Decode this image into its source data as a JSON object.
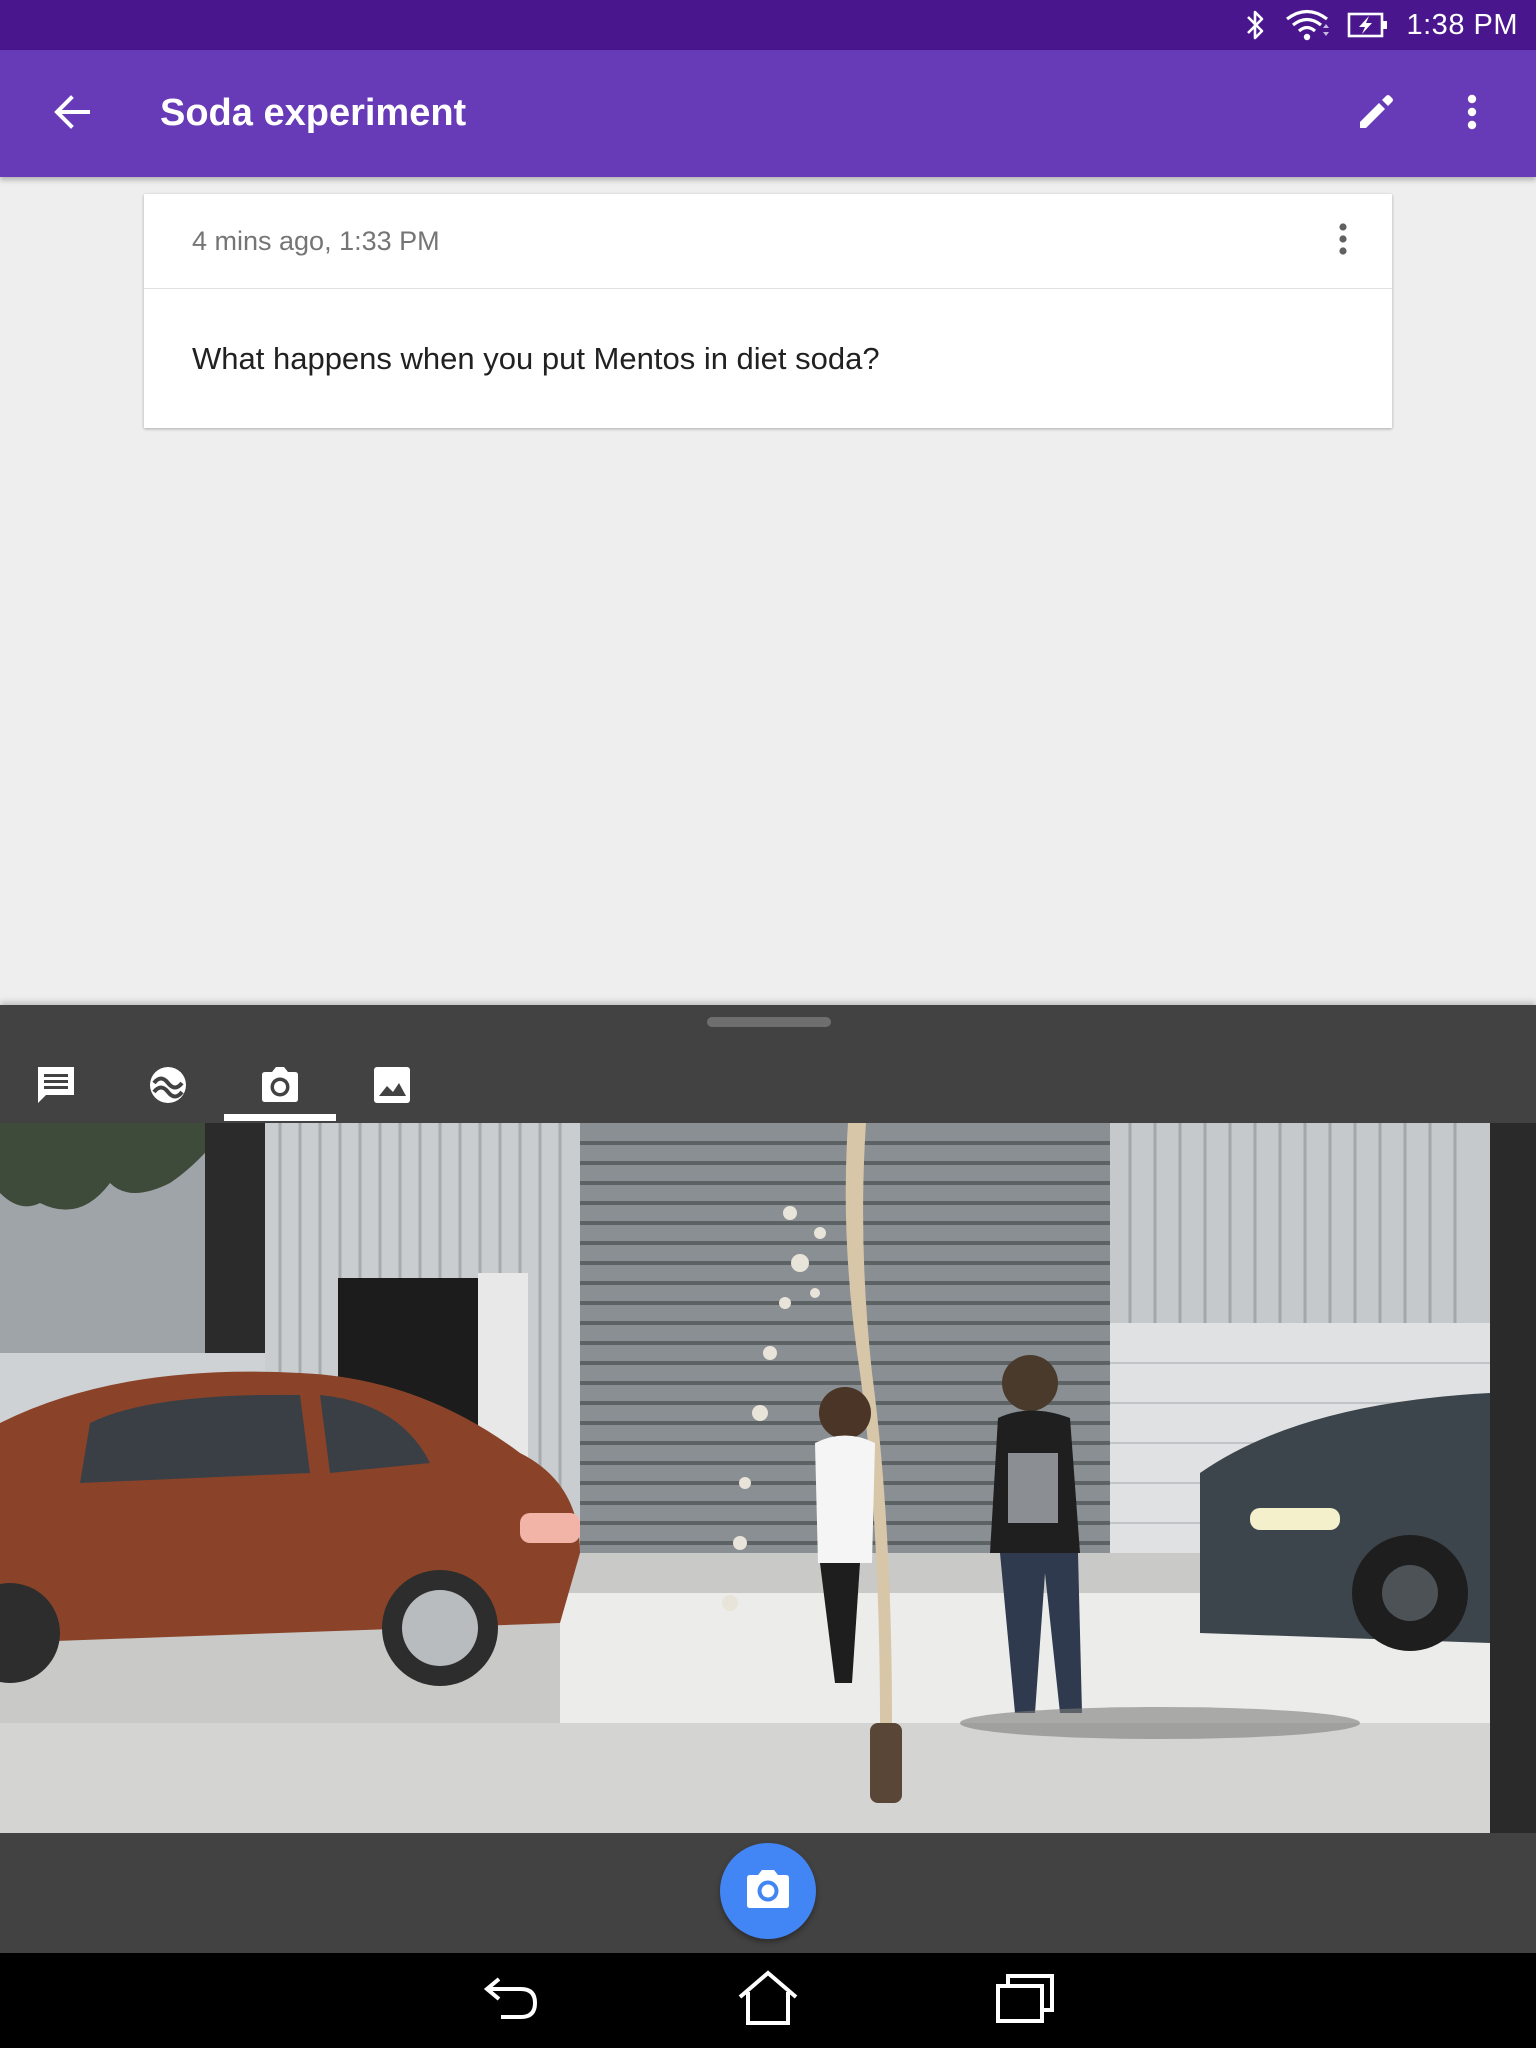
{
  "status_bar": {
    "time": "1:38 PM",
    "icons": [
      "bluetooth-icon",
      "wifi-icon",
      "battery-charging-icon"
    ]
  },
  "app_bar": {
    "title": "Soda experiment",
    "back_icon": "arrow-back-icon",
    "edit_icon": "pencil-icon",
    "more_icon": "more-vert-icon",
    "color": "#673ab7",
    "status_color": "#4a168e"
  },
  "note": {
    "timestamp": "4 mins ago, 1:33 PM",
    "text": "What happens when you put Mentos in diet soda?",
    "more_icon": "more-vert-icon"
  },
  "panel": {
    "tabs": [
      {
        "icon": "comment-icon",
        "selected": false
      },
      {
        "icon": "sensor-wave-icon",
        "selected": false
      },
      {
        "icon": "camera-icon",
        "selected": true
      },
      {
        "icon": "gallery-image-icon",
        "selected": false
      }
    ],
    "preview_image": "camera-preview-photo",
    "shutter_icon": "camera-icon",
    "shutter_color": "#4285f4"
  },
  "nav_bar": {
    "buttons": [
      "back-nav-icon",
      "home-nav-icon",
      "recents-nav-icon"
    ]
  }
}
